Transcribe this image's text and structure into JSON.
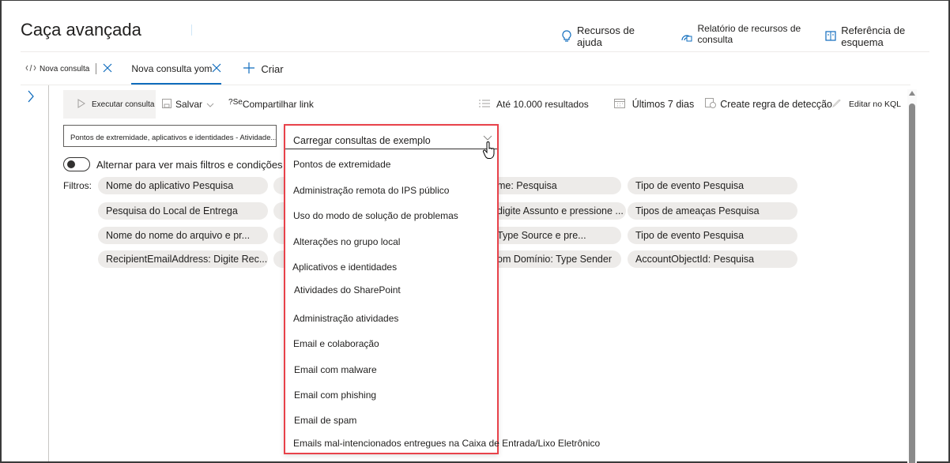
{
  "page": {
    "title": "Caça avançada"
  },
  "header_links": [
    {
      "icon": "lightbulb-icon",
      "label": "Recursos de ajuda"
    },
    {
      "icon": "report-icon",
      "label": "Relatório de recursos de consulta"
    },
    {
      "icon": "book-icon",
      "label": "Referência de esquema"
    }
  ],
  "tabs": [
    {
      "label": "Nova consulta",
      "icon": "query-icon",
      "active": false
    },
    {
      "label": "Nova consulta yom",
      "active": true
    },
    {
      "label": "Criar",
      "icon": "plus-icon"
    }
  ],
  "toolbar": {
    "run": "Executar consulta",
    "save": "Salvar",
    "share_prefix": "?Se",
    "share": "Compartilhar link",
    "results": "Até 10.000 resultados",
    "timerange": "Últimos 7 dias",
    "create_rule": "Create regra de detecção",
    "edit_kql": "Editar no KQL"
  },
  "scope": {
    "value": "Pontos de extremidade, aplicativos e identidades - Atividade..."
  },
  "toggle": {
    "label": "Alternar para ver mais filtros e condições",
    "on": false
  },
  "filters": {
    "label": "Filtros:",
    "col1": [
      "Nome do aplicativo Pesquisa",
      "Pesquisa do Local de Entrega",
      "Nome do nome do arquivo e pr...",
      "RecipientEmailAddress: Digite Rec..."
    ],
    "col3": [
      "me: Pesquisa",
      "digite Assunto e pressione ...",
      " Type Source e pre...",
      "om Domínio: Type Sender"
    ],
    "col4": [
      "Tipo de evento Pesquisa",
      "Tipos de ameaças Pesquisa",
      "Tipo de evento Pesquisa",
      "AccountObjectId: Pesquisa"
    ]
  },
  "dropdown": {
    "placeholder": "Carregar consultas de exemplo",
    "items": [
      "Pontos de extremidade",
      "Administração remota do IPS público",
      "Uso do modo de solução de problemas",
      "Alterações no grupo local",
      "Aplicativos e identidades",
      "Atividades do SharePoint",
      "Administração atividades",
      "Email e colaboração",
      "Email com malware",
      "Email com phishing",
      "Email de spam",
      "Emails mal-intencionados entregues na Caixa de Entrada/Lixo Eletrônico"
    ]
  },
  "colors": {
    "accent": "#0f6cbd",
    "highlight_border": "#e8424a"
  }
}
